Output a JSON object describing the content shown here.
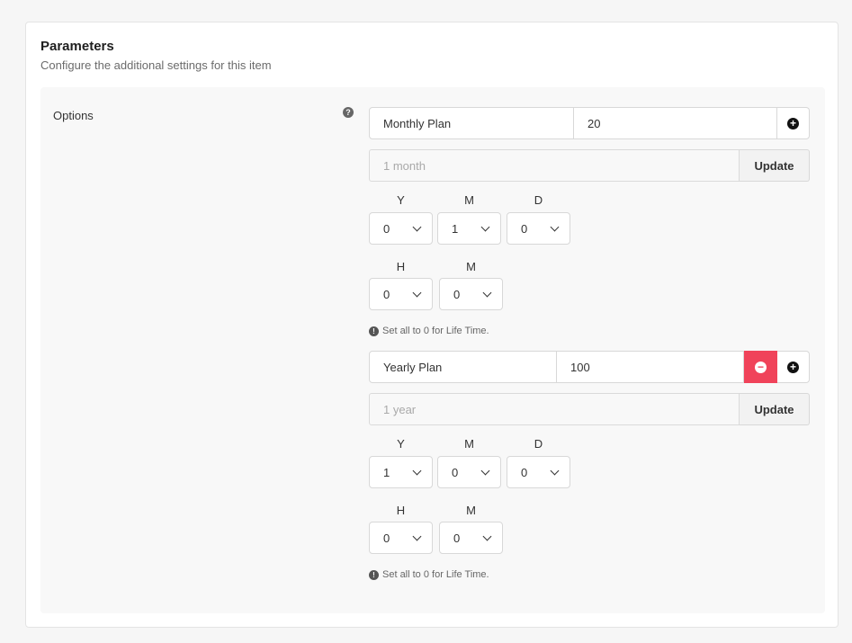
{
  "section": {
    "title": "Parameters",
    "subtitle": "Configure the additional settings for this item"
  },
  "field": {
    "label": "Options",
    "help_icon": "question-circle-icon"
  },
  "options": [
    {
      "name": "Monthly Plan",
      "price": "20",
      "duration_placeholder": "1 month",
      "update_label": "Update",
      "date_labels": {
        "y": "Y",
        "m": "M",
        "d": "D"
      },
      "date_values": {
        "y": "0",
        "m": "1",
        "d": "0"
      },
      "time_labels": {
        "h": "H",
        "m": "M"
      },
      "time_values": {
        "h": "0",
        "m": "0"
      },
      "note": "Set all to 0 for Life Time."
    },
    {
      "name": "Yearly Plan",
      "price": "100",
      "duration_placeholder": "1 year",
      "update_label": "Update",
      "date_labels": {
        "y": "Y",
        "m": "M",
        "d": "D"
      },
      "date_values": {
        "y": "1",
        "m": "0",
        "d": "0"
      },
      "time_labels": {
        "h": "H",
        "m": "M"
      },
      "time_values": {
        "h": "0",
        "m": "0"
      },
      "note": "Set all to 0 for Life Time."
    }
  ],
  "colors": {
    "remove_button": "#f0435a",
    "panel_bg": "#f8f8f8"
  }
}
